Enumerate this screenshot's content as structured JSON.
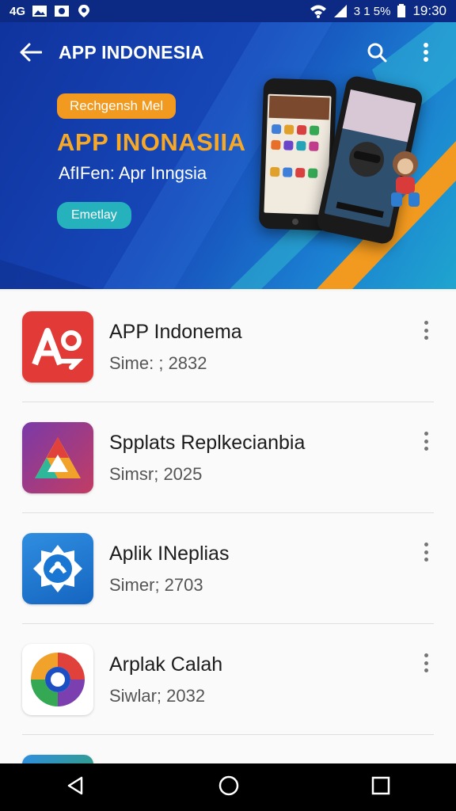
{
  "status_bar": {
    "left_icons": [
      "carrier-4g-icon",
      "image-notification-icon",
      "photo-notification-icon",
      "location-pin-icon"
    ],
    "left_text": "4G",
    "battery_text": "3 1 5%",
    "time": "19:30"
  },
  "app_bar": {
    "title": "APP INDONESIA"
  },
  "banner": {
    "pill": "Rechgensh Mel",
    "title": "APP INONASIIA",
    "subtitle": "AfIFen: Apr Inngsia",
    "button": "Emetlay"
  },
  "apps": [
    {
      "name": "APP Indonema",
      "meta": "Sime: ; 2832",
      "icon": "ao-logo-icon"
    },
    {
      "name": "Spplats Replkecianbia",
      "meta": "Simsr; 2025",
      "icon": "triangle-logo-icon"
    },
    {
      "name": "Aplik INeplias",
      "meta": "Simer; 2703",
      "icon": "badge-logo-icon"
    },
    {
      "name": "Arplak Calah",
      "meta": "Siwlar; 2032",
      "icon": "ring-logo-icon"
    }
  ],
  "colors": {
    "accent_orange": "#f29a1f",
    "hero_blue": "#1647b8",
    "teal": "#25b2bd"
  }
}
